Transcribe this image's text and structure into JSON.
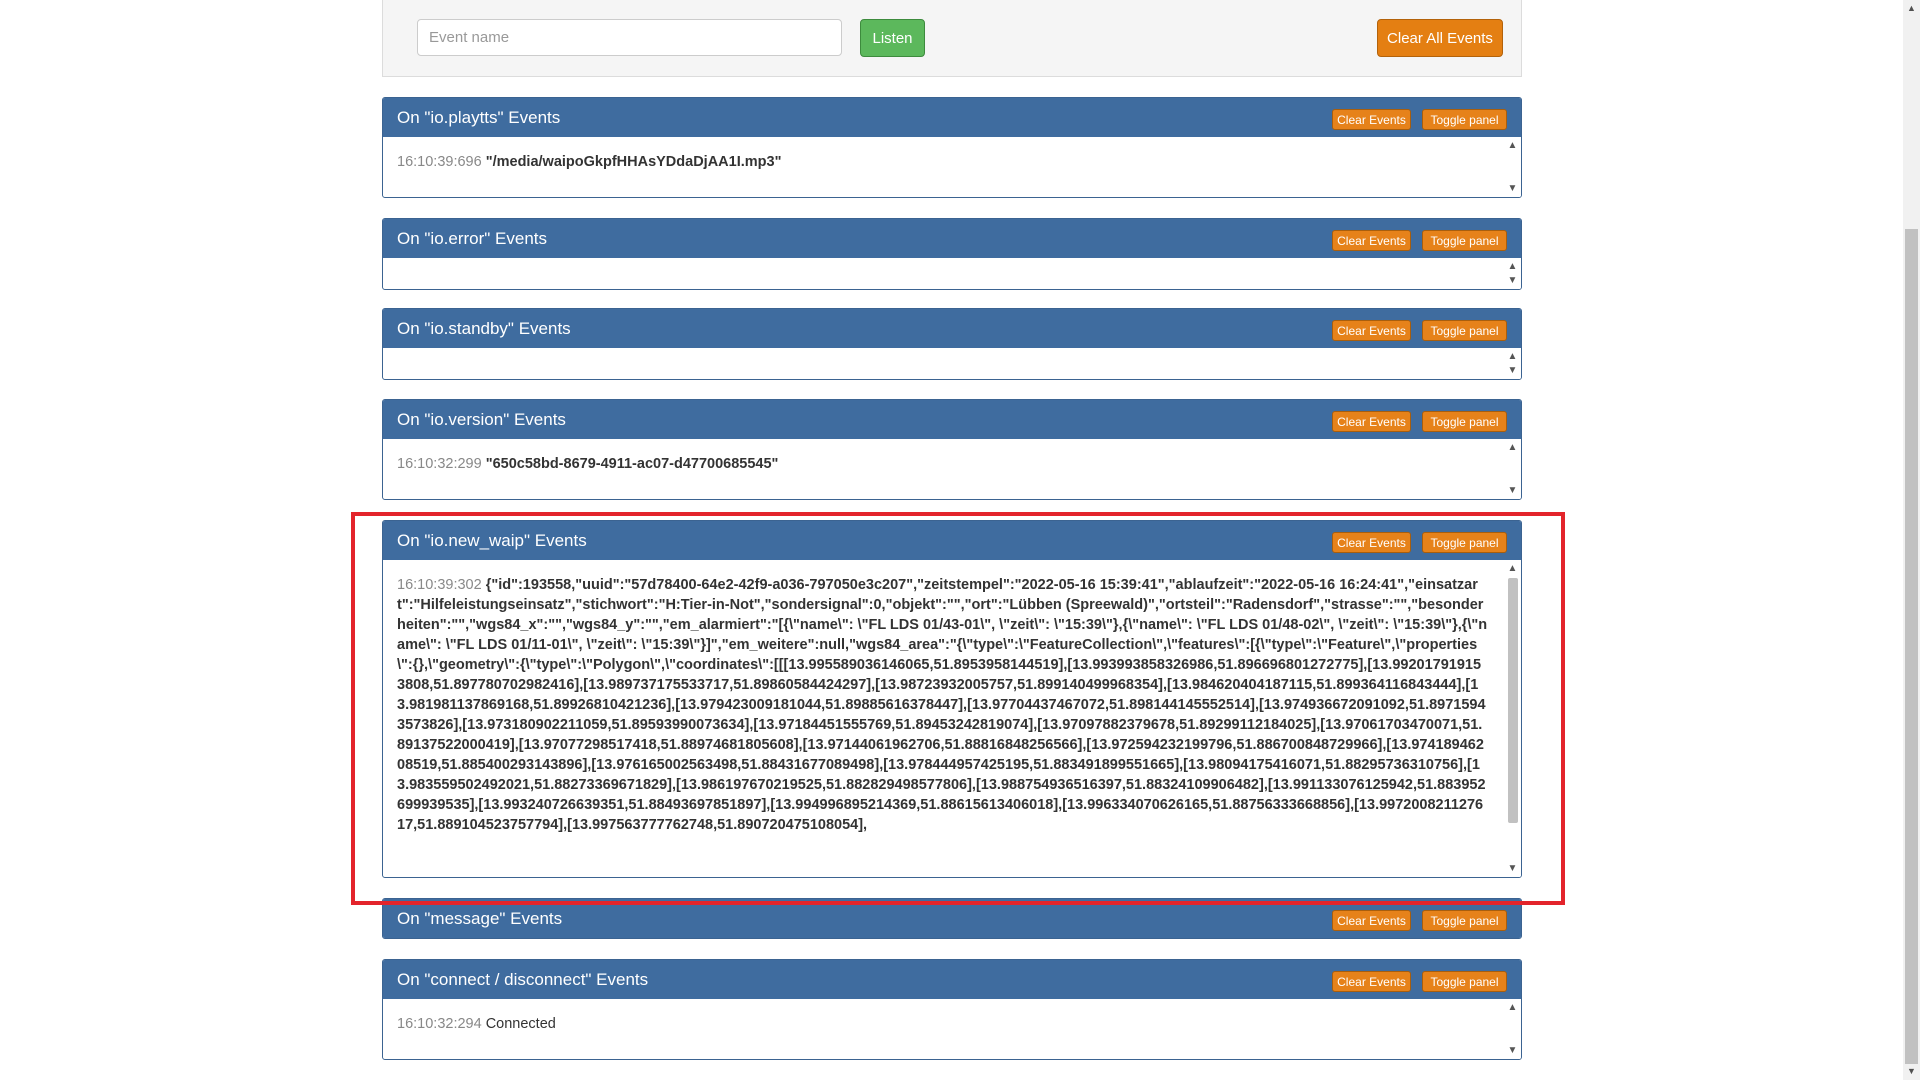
{
  "toolbar": {
    "event_placeholder": "Event name",
    "listen_label": "Listen",
    "clear_all_label": "Clear All Events"
  },
  "panel_buttons": {
    "clear": "Clear Events",
    "toggle": "Toggle panel"
  },
  "scroll_icons": {
    "up": "▲",
    "down": "▼"
  },
  "panels": [
    {
      "title": "On \"io.playtts\" Events",
      "events": [
        {
          "time": "16:10:39:696",
          "value": "\"/media/waipoGkpfHHAsYDdaDjAA1I.mp3\""
        }
      ]
    },
    {
      "title": "On \"io.error\" Events",
      "events": []
    },
    {
      "title": "On \"io.standby\" Events",
      "events": []
    },
    {
      "title": "On \"io.version\" Events",
      "events": [
        {
          "time": "16:10:32:299",
          "value": "\"650c58bd-8679-4911-ac07-d47700685545\""
        }
      ]
    },
    {
      "title": "On \"io.new_waip\" Events",
      "events": [
        {
          "time": "16:10:39:302",
          "value": "{\"id\":193558,\"uuid\":\"57d78400-64e2-42f9-a036-797050e3c207\",\"zeitstempel\":\"2022-05-16 15:39:41\",\"ablaufzeit\":\"2022-05-16 16:24:41\",\"einsatzart\":\"Hilfeleistungseinsatz\",\"stichwort\":\"H:Tier-in-Not\",\"sondersignal\":0,\"objekt\":\"\",\"ort\":\"Lübben (Spreewald)\",\"ortsteil\":\"Radensdorf\",\"strasse\":\"\",\"besonderheiten\":\"\",\"wgs84_x\":\"\",\"wgs84_y\":\"\",\"em_alarmiert\":\"[{\\\"name\\\": \\\"FL LDS 01/43-01\\\", \\\"zeit\\\": \\\"15:39\\\"},{\\\"name\\\": \\\"FL LDS 01/48-02\\\", \\\"zeit\\\": \\\"15:39\\\"},{\\\"name\\\": \\\"FL LDS 01/11-01\\\", \\\"zeit\\\": \\\"15:39\\\"}]\",\"em_weitere\":null,\"wgs84_area\":\"{\\\"type\\\":\\\"FeatureCollection\\\",\\\"features\\\":[{\\\"type\\\":\\\"Feature\\\",\\\"properties\\\":{},\\\"geometry\\\":{\\\"type\\\":\\\"Polygon\\\",\\\"coordinates\\\":[[[13.995589036146065,51.8953958144519],[13.993993858326986,51.896696801272775],[13.992017919153808,51.897780702982416],[13.9897371755337​17,51.89860584424297],[13.98723932005757,51.899140499968354],[13.984620404187115,51.899364116843444],[13.981981137869168,51.89926810421236],[13.979423009181044,51.89885616378447],[13.97704437467072,51.898144145552514],[13.974936672091092,51.89715943573826],[13.973180902211059,51.89593990073634],[13.97184451555769,51.89453242819074],[13.97097882379678,51.89299112184025],[13.97061703470071,51.89137522000419],[13.97077298517418,51.88974681805608],[13.97144061962706,51.88816848256566],[13.972594232199796,51.886700848729966],[13.97418946208519,51.885400293143896],[13.976165002563498,51.88431677089498],[13.978444957425195,51.883491899551665],[13.98094175416071,51.88295736310756],[13.983559502492021,51.88273369671829],[13.986197670219525,51.882829498577806],[13.988754936516397,51.88324109906482],[13.991133076125942,51.883952699939535],[13.993240726639351,51.88493697851897],[13.994996895214369,51.88615613406018],[13.996334070626165,51.88756333668856],[13.997200821127617,51.889104523757794],[13.997563777762748,51.890720475108054],"
        }
      ]
    },
    {
      "title": "On \"message\" Events",
      "events": []
    },
    {
      "title": "On \"connect / disconnect\" Events",
      "events": [
        {
          "time": "16:10:32:294",
          "value": "Connected"
        }
      ]
    }
  ]
}
